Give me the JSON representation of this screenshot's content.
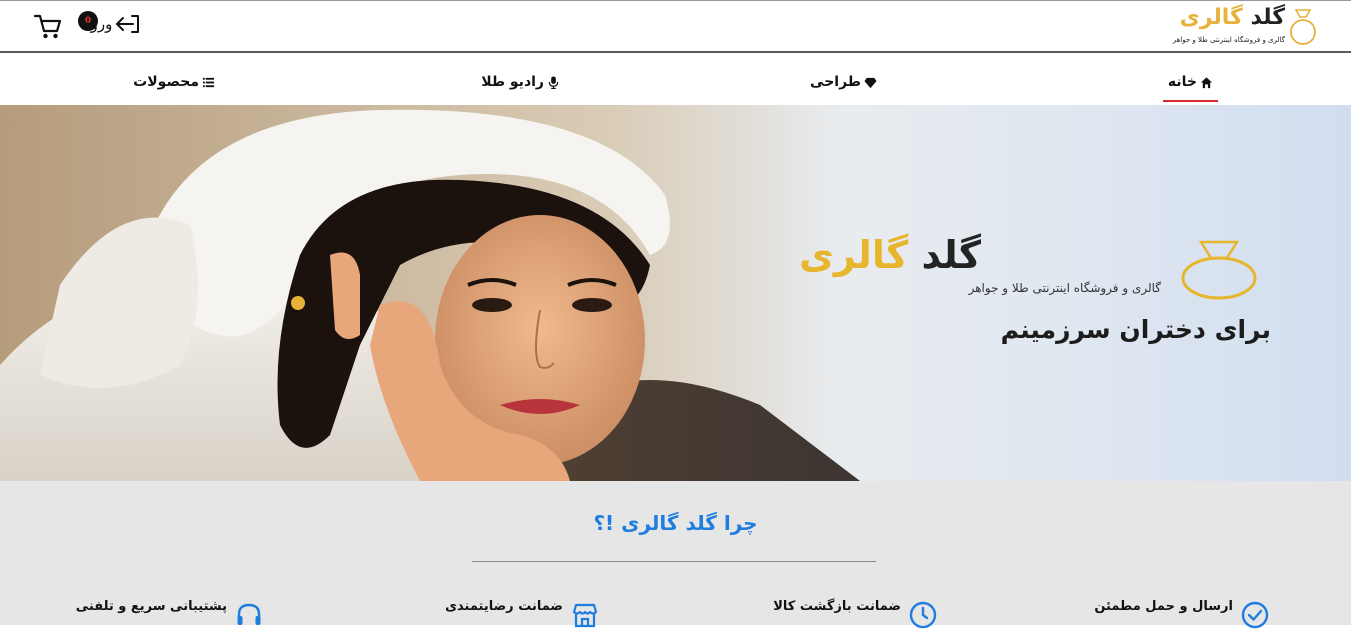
{
  "header": {
    "logo": {
      "title_a": "گلد",
      "title_b": "گالری",
      "subtitle": "گالری و فروشگاه اینترنتی طلا و جواهر"
    },
    "login_label": "ورود",
    "cart_count": "0"
  },
  "nav": {
    "items": [
      {
        "label": "خانه",
        "icon": "home-icon",
        "active": true
      },
      {
        "label": "طراحی",
        "icon": "gem-icon",
        "active": false
      },
      {
        "label": "رادیو طلا",
        "icon": "microphone-icon",
        "active": false
      },
      {
        "label": "محصولات",
        "icon": "list-icon",
        "active": false
      }
    ]
  },
  "hero": {
    "logo_title_a": "گلد",
    "logo_title_b": "گالری",
    "logo_subtitle": "گالری و فروشگاه اینترنتی طلا و جواهر",
    "tagline": "برای دختران سرزمینم"
  },
  "why": {
    "title": "چرا گلد گالری !؟",
    "features": [
      {
        "label": "ارسال و حمل مطمئن",
        "icon": "check-circle-icon"
      },
      {
        "label": "ضمانت بازگشت کالا",
        "icon": "clock-icon"
      },
      {
        "label": "ضمانت رضایتمندی",
        "icon": "store-icon"
      },
      {
        "label": "پشتیبانی سریع و تلفنی",
        "icon": "headset-icon"
      }
    ]
  },
  "colors": {
    "accent_blue": "#1f7de0",
    "accent_gold": "#e8b62c",
    "active_underline": "#d8292c",
    "section_bg": "#e6e6e6"
  }
}
